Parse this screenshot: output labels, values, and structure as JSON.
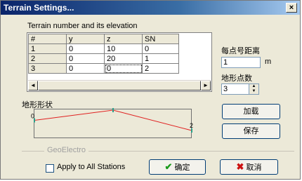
{
  "window": {
    "title": "Terrain Settings...",
    "close_glyph": "×"
  },
  "caption": "Terrain number and its elevation",
  "grid": {
    "columns": [
      "#",
      "y",
      "z",
      "SN"
    ],
    "rows": [
      [
        "1",
        "0",
        "10",
        "0"
      ],
      [
        "2",
        "0",
        "20",
        "1"
      ],
      [
        "3",
        "0",
        "0",
        "2"
      ]
    ],
    "scroll_left": "◄",
    "scroll_right": "►"
  },
  "spacing": {
    "label": "每点号距离",
    "value": "1",
    "unit": "m"
  },
  "terrain_count": {
    "label": "地形点数",
    "value": "3",
    "up": "▲",
    "down": "▼"
  },
  "load_button": "加载",
  "save_button": "保存",
  "terrain_shape": {
    "title": "地形形状",
    "start_label": "0",
    "end_label": "2",
    "elevations": [
      10,
      20,
      0
    ],
    "line_color": "#e02020",
    "marker_color": "#2aa08a"
  },
  "group_label": "GeoElectro",
  "apply_all": {
    "label": "Apply to All Stations",
    "checked": false
  },
  "ok_button": {
    "icon": "✔",
    "label": "确定"
  },
  "cancel_button": {
    "icon": "✖",
    "label": "取消"
  }
}
